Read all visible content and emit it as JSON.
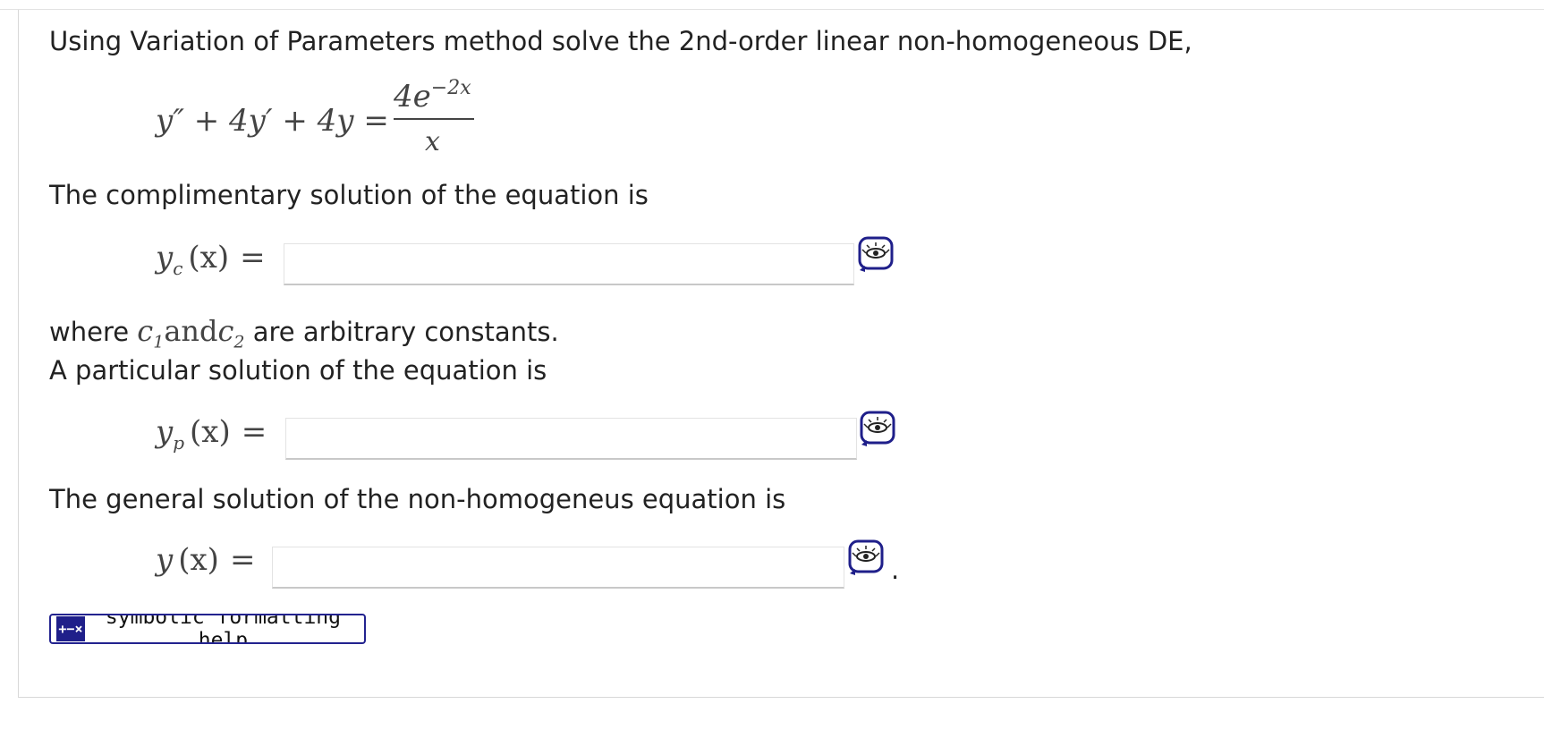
{
  "question": {
    "prompt": "Using Variation of Parameters method solve the 2nd-order linear non-homogeneous DE,",
    "equation": {
      "lhs": "y″ + 4y′ + 4y =",
      "numerator": "4e",
      "exponent": "−2x",
      "denominator": "x"
    },
    "complementary_prompt": "The complimentary solution of the equation is",
    "yc_label": "y",
    "yc_sub": "c",
    "yc_arg": "(x)",
    "yc_eq": "=",
    "yc_value": "",
    "where_text": "where",
    "c1": "c",
    "c1_sub": "1",
    "and_text": "and",
    "c2": "c",
    "c2_sub": "2",
    "constants_text": "are arbitrary constants.",
    "particular_prompt": "A particular solution of the equation is",
    "yp_label": "y",
    "yp_sub": "p",
    "yp_arg": "(x)",
    "yp_eq": "=",
    "yp_value": "",
    "general_prompt": "The general solution of the non-homogeneus equation is",
    "y_label": "y",
    "y_arg": "(x)",
    "y_eq": "=",
    "y_value": "",
    "period": "."
  },
  "help": {
    "icon_text": "+−×",
    "label": "symbolic formatting help"
  },
  "icons": {
    "preview": "eye-preview-icon",
    "help": "plus-minus-times-icon"
  },
  "colors": {
    "accent": "#1f1f8a",
    "text": "#222222",
    "math": "#444444"
  }
}
